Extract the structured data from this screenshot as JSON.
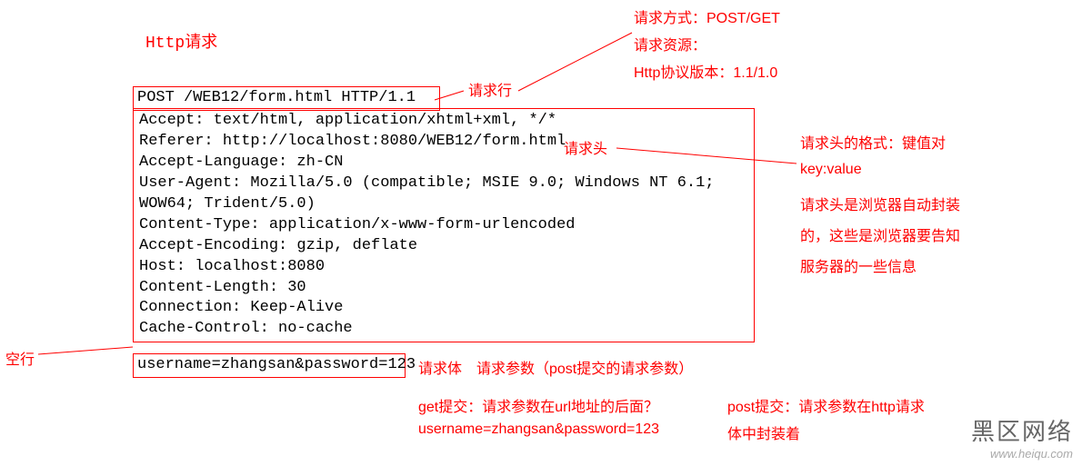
{
  "title": "Http请求",
  "requestLine": "POST /WEB12/form.html HTTP/1.1",
  "labels": {
    "requestLine": "请求行",
    "requestHeaders": "请求头",
    "emptyLine": "空行",
    "requestBody": "请求体",
    "requestParamsNote": "请求参数（post提交的请求参数）"
  },
  "requestLineNotes": {
    "method": "请求方式：POST/GET",
    "resource": "请求资源：",
    "version": "Http协议版本：1.1/1.0"
  },
  "headers": {
    "line1": "Accept: text/html, application/xhtml+xml, */*",
    "line2": "Referer: http://localhost:8080/WEB12/form.html",
    "line3": "Accept-Language: zh-CN",
    "line4": "User-Agent: Mozilla/5.0 (compatible; MSIE 9.0; Windows NT 6.1;",
    "line5": "WOW64; Trident/5.0)",
    "line6": "Content-Type: application/x-www-form-urlencoded",
    "line7": "Accept-Encoding: gzip, deflate",
    "line8": "Host: localhost:8080",
    "line9": "Content-Length: 30",
    "line10": "Connection: Keep-Alive",
    "line11": "Cache-Control: no-cache"
  },
  "headersNotes": {
    "format": "请求头的格式：键值对",
    "kv": "key:value",
    "desc1": "请求头是浏览器自动封装",
    "desc2": "的，这些是浏览器要告知",
    "desc3": "服务器的一些信息"
  },
  "body": "username=zhangsan&password=123",
  "bodyNotes": {
    "getPrefix": "get提交：请求参数在url地址的后面？",
    "getExample": "username=zhangsan&password=123",
    "postLine1": "post提交：请求参数在http请求",
    "postLine2": "体中封装着"
  },
  "watermark": {
    "big": "黑区网络",
    "small": "www.heiqu.com"
  }
}
